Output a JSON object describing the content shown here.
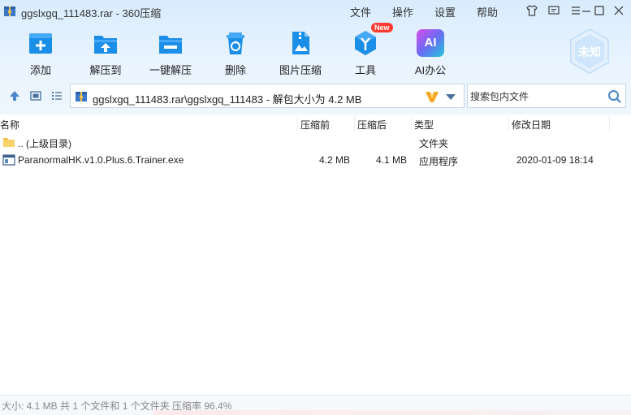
{
  "window": {
    "title": "ggslxgq_111483.rar - 360压缩",
    "menu": [
      "文件",
      "操作",
      "设置",
      "帮助"
    ]
  },
  "toolbar": {
    "items": [
      {
        "label": "添加",
        "icon": "add-icon"
      },
      {
        "label": "解压到",
        "icon": "extract-to-icon"
      },
      {
        "label": "一键解压",
        "icon": "one-click-extract-icon"
      },
      {
        "label": "删除",
        "icon": "recycle-bin-icon"
      },
      {
        "label": "图片压缩",
        "icon": "image-compress-icon"
      },
      {
        "label": "工具",
        "icon": "tools-icon",
        "badge": "New"
      },
      {
        "label": "AI办公",
        "icon": "ai-icon",
        "icon_text": "AI"
      }
    ],
    "account_badge": "未知"
  },
  "address": {
    "path": "ggslxgq_111483.rar\\ggslxgq_111483 - 解包大小为 4.2 MB"
  },
  "search": {
    "placeholder": "搜索包内文件"
  },
  "columns": {
    "name": "名称",
    "packed_before": "压缩前",
    "packed_after": "压缩后",
    "type": "类型",
    "modified": "修改日期"
  },
  "rows": [
    {
      "name": ".. (上级目录)",
      "before": "",
      "after": "",
      "type": "文件夹",
      "modified": "",
      "icon": "folder-icon"
    },
    {
      "name": "ParanormalHK.v1.0.Plus.6.Trainer.exe",
      "before": "4.2 MB",
      "after": "4.1 MB",
      "type": "应用程序",
      "modified": "2020-01-09 18:14",
      "icon": "exe-file-icon"
    }
  ],
  "status": {
    "text": "大小: 4.1 MB 共 1 个文件和 1 个文件夹 压缩率 96.4%"
  },
  "colors": {
    "accent": "#1b8ee8",
    "badge_red": "#ff3b30",
    "folder": "#f5c24c"
  }
}
